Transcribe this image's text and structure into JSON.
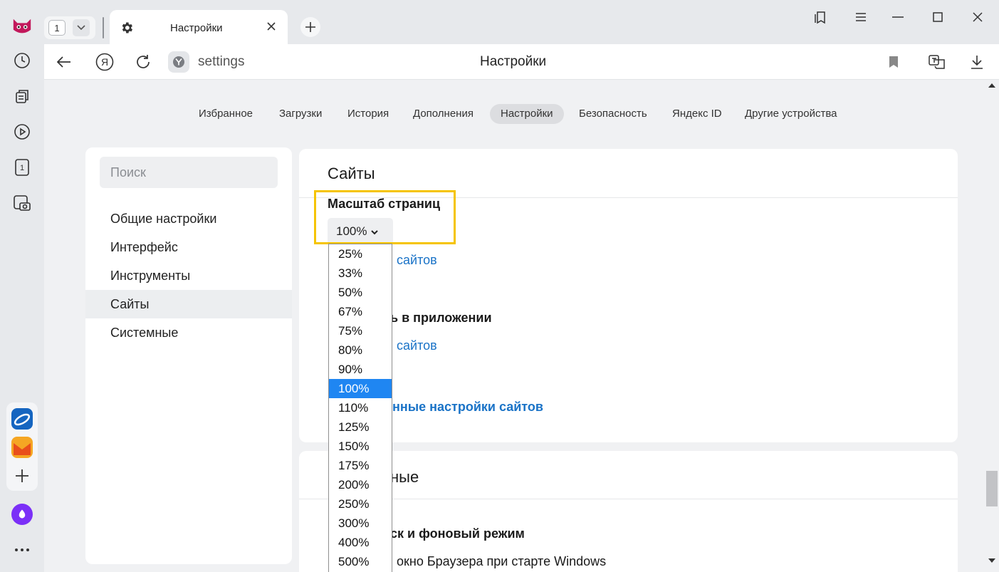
{
  "tabs": {
    "counter": "1",
    "active_title": "Настройки"
  },
  "address_bar": {
    "url": "settings",
    "page_title": "Настройки"
  },
  "top_nav": [
    {
      "label": "Избранное"
    },
    {
      "label": "Загрузки"
    },
    {
      "label": "История"
    },
    {
      "label": "Дополнения"
    },
    {
      "label": "Настройки",
      "active": true
    },
    {
      "label": "Безопасность"
    },
    {
      "label": "Яндекс ID"
    },
    {
      "label": "Другие устройства"
    }
  ],
  "sidebar": {
    "search_placeholder": "Поиск",
    "items": [
      {
        "label": "Общие настройки"
      },
      {
        "label": "Интерфейс"
      },
      {
        "label": "Инструменты"
      },
      {
        "label": "Сайты",
        "selected": true
      },
      {
        "label": "Системные"
      }
    ]
  },
  "sites_card": {
    "heading": "Сайты",
    "zoom_label": "Масштаб страниц",
    "zoom_value": "100%",
    "link1": "сайтов",
    "sub2": "ь в приложении",
    "link2": "сайтов",
    "link3": "нные настройки сайтов"
  },
  "system_card": {
    "heading": "ные",
    "sub": "ск и фоновый режим",
    "text": "окно Браузера при старте Windows"
  },
  "zoom_dropdown": {
    "options": [
      "25%",
      "33%",
      "50%",
      "67%",
      "75%",
      "80%",
      "90%",
      "100%",
      "110%",
      "125%",
      "150%",
      "175%",
      "200%",
      "250%",
      "300%",
      "400%",
      "500%"
    ],
    "selected": "100%"
  },
  "colors": {
    "accent": "#1f86f2",
    "link": "#1a73c7",
    "highlight": "#f5c400"
  }
}
